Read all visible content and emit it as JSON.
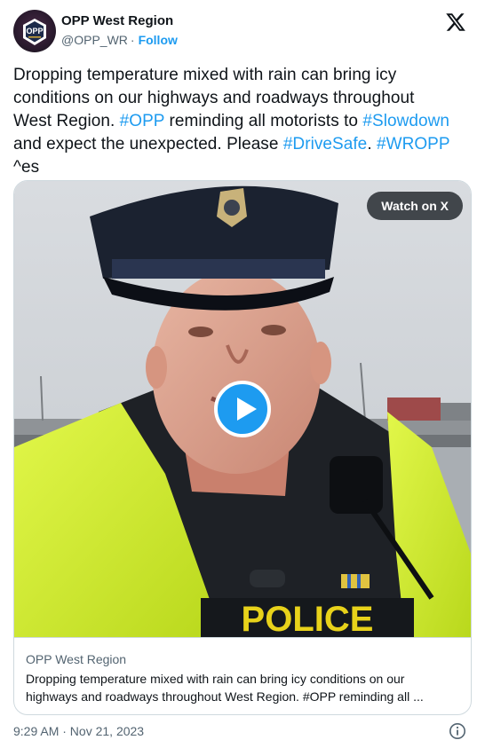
{
  "account": {
    "display_name": "OPP West Region",
    "handle": "@OPP_WR",
    "separator": "·",
    "follow_label": "Follow",
    "avatar_text": "OPP",
    "avatar_icon": "opp-crest-icon"
  },
  "platform": {
    "logo_icon": "x-logo-icon"
  },
  "tweet": {
    "lines": [
      [
        {
          "text": "Dropping temperature mixed with rain can bring icy",
          "link": false
        }
      ],
      [
        {
          "text": "conditions on our highways and roadways throughout",
          "link": false
        }
      ],
      [
        {
          "text": "West Region. ",
          "link": false
        },
        {
          "text": "#OPP",
          "link": true
        },
        {
          "text": " reminding all motorists to ",
          "link": false
        },
        {
          "text": "#Slowdown",
          "link": true
        }
      ],
      [
        {
          "text": "and expect the unexpected. Please ",
          "link": false
        },
        {
          "text": "#DriveSafe",
          "link": true
        },
        {
          "text": ". ",
          "link": false
        },
        {
          "text": "#WROPP",
          "link": true
        }
      ],
      [
        {
          "text": "^es",
          "link": false
        }
      ]
    ]
  },
  "media": {
    "watch_label": "Watch on X",
    "play_icon": "play-icon",
    "vest_text": "POLICE",
    "link_preview": {
      "domain": "OPP West Region",
      "description": "Dropping temperature mixed with rain can bring icy conditions on our highways and roadways throughout West Region. #OPP reminding all ..."
    }
  },
  "footer": {
    "timestamp": "9:29 AM · Nov 21, 2023",
    "info_icon": "info-icon"
  },
  "colors": {
    "accent": "#1d9bf0",
    "text": "#0f1419",
    "secondary": "#536471",
    "border": "#cfd9de",
    "vest": "#d4f22a"
  }
}
